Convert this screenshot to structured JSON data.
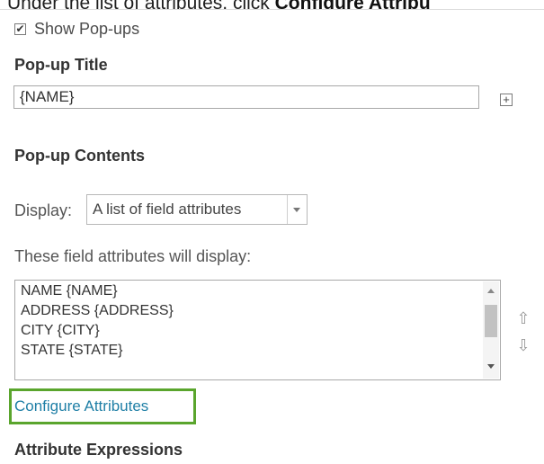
{
  "instruction": {
    "prefix": "Under the list of attributes, click ",
    "bold": "Configure Attribu"
  },
  "show_popups": {
    "label": "Show Pop-ups",
    "checked": true
  },
  "popup_title": {
    "heading": "Pop-up Title",
    "value": "{NAME}"
  },
  "popup_contents": {
    "heading": "Pop-up Contents"
  },
  "display": {
    "label": "Display:",
    "selected": "A list of field attributes"
  },
  "fields": {
    "label": "These field attributes will display:",
    "items": [
      "NAME {NAME}",
      "ADDRESS {ADDRESS}",
      "CITY {CITY}",
      "STATE {STATE}"
    ]
  },
  "configure_attributes": {
    "label": "Configure Attributes",
    "highlight_color": "#5aa52d",
    "link_color": "#1f7fa6"
  },
  "attribute_expressions": {
    "heading": "Attribute Expressions"
  },
  "icons": {
    "checkbox": "checkbox-checked-icon",
    "plus": "plus-box-icon",
    "move_up": "move-up-arrow-icon",
    "move_down": "move-down-arrow-icon",
    "dropdown": "chevron-down-icon"
  }
}
